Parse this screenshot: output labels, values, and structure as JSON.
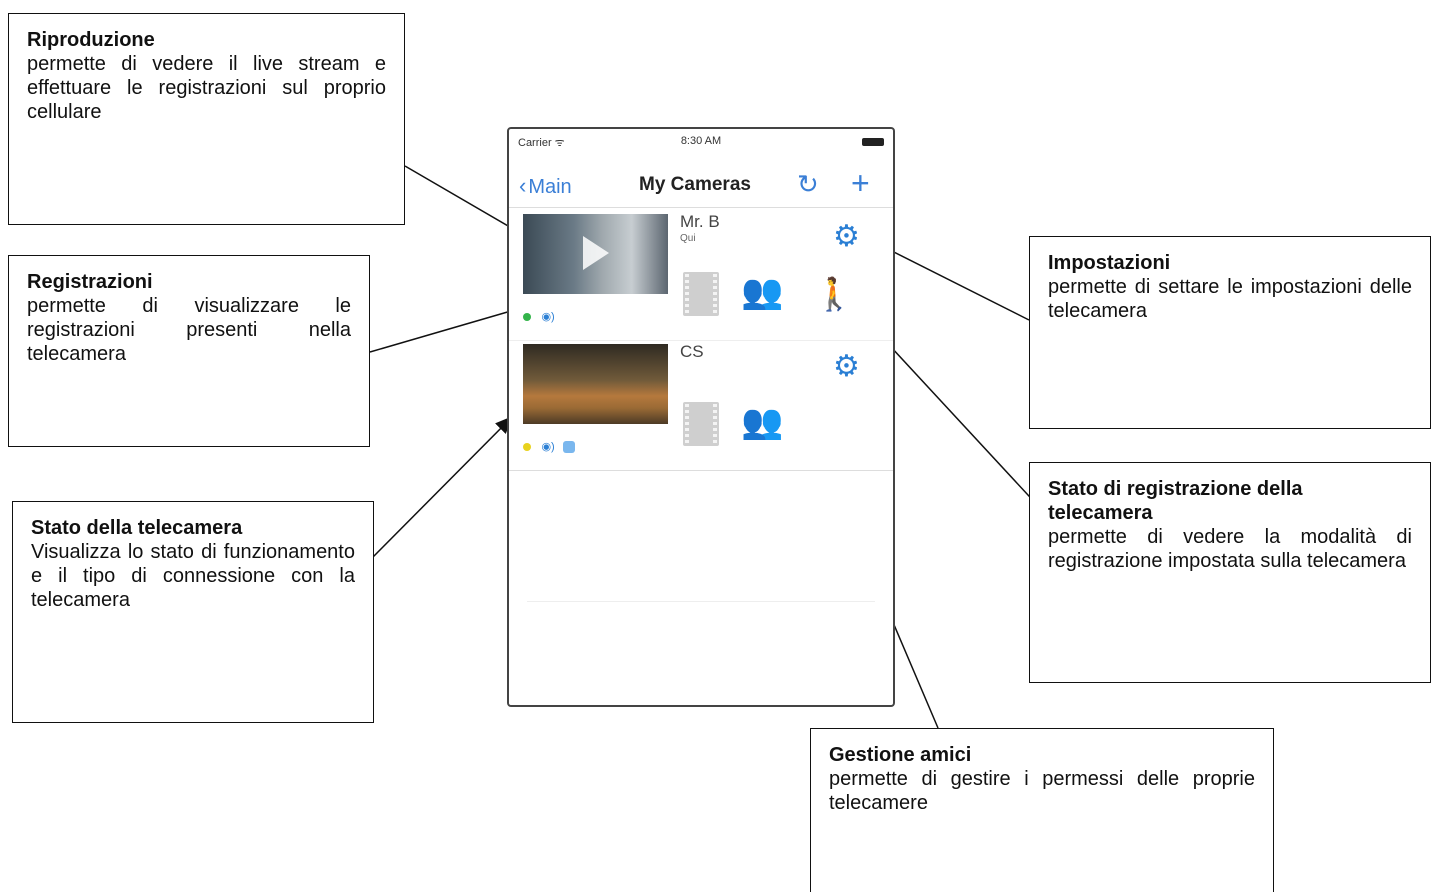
{
  "callouts": {
    "riproduzione": {
      "title": "Riproduzione",
      "desc": "permette di vedere il live stream e effettuare le registrazioni sul proprio cellulare"
    },
    "registrazioni": {
      "title": "Registrazioni",
      "desc": "permette di visualizzare le registrazioni presenti nella telecamera"
    },
    "stato_telecamera": {
      "title": "Stato della telecamera",
      "desc": "Visualizza lo stato di funzionamento e il tipo di connessione con la telecamera"
    },
    "impostazioni": {
      "title": "Impostazioni",
      "desc": "permette di settare le impostazioni delle telecamera"
    },
    "stato_registrazione": {
      "title": "Stato di registrazione della telecamera",
      "desc": "permette di vedere la modalità di registrazione impostata sulla telecamera"
    },
    "gestione_amici": {
      "title": "Gestione amici",
      "desc": "permette di gestire i permessi delle proprie telecamere"
    }
  },
  "phone": {
    "statusbar": {
      "carrier": "Carrier ᯤ",
      "time": "8:30 AM"
    },
    "navbar": {
      "back": "Main",
      "title": "My Cameras",
      "refresh_icon": "refresh-icon",
      "add_icon": "plus-icon"
    },
    "cameras": [
      {
        "name": "Mr. B",
        "subtitle": "Qui",
        "status_color": "#33b44a"
      },
      {
        "name": "CS",
        "subtitle": "",
        "status_color": "#e8d21e"
      }
    ]
  },
  "colors": {
    "accent": "#3b7fd6"
  }
}
